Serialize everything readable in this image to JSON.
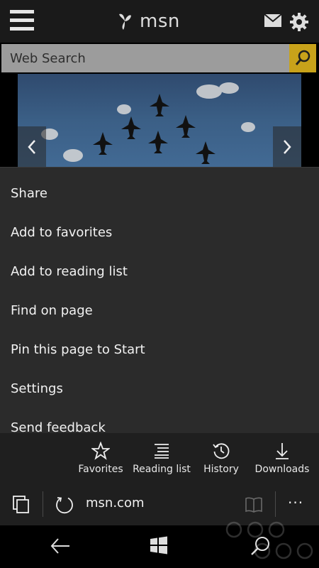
{
  "header": {
    "brand": "msn"
  },
  "search": {
    "placeholder": "Web Search"
  },
  "menu": {
    "items": [
      "Share",
      "Add to favorites",
      "Add to reading list",
      "Find on page",
      "Pin this page to Start",
      "Settings",
      "Send feedback"
    ]
  },
  "actions": [
    {
      "label": "Favorites",
      "icon": "star-icon"
    },
    {
      "label": "Reading list",
      "icon": "reading-list-icon"
    },
    {
      "label": "History",
      "icon": "history-icon"
    },
    {
      "label": "Downloads",
      "icon": "download-icon"
    }
  ],
  "addressbar": {
    "url": "msn.com",
    "more": "···"
  },
  "colors": {
    "accent": "#c8a21a",
    "menu_bg": "#2b2b2b",
    "bar_bg": "#1f1f1f"
  }
}
